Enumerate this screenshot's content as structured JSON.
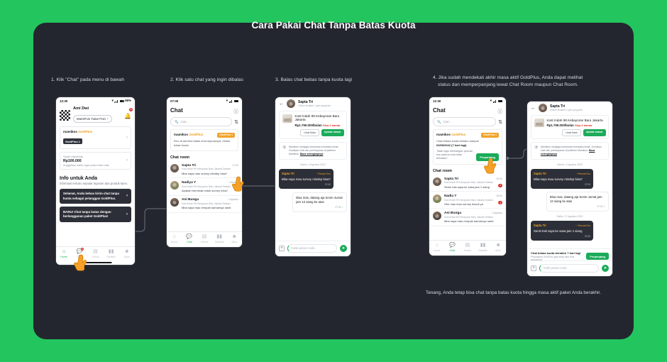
{
  "deck": {
    "title": "Cara Pakai Chat Tanpa Batas Kuota",
    "footnote": "Tenang, Anda tetap bisa chat tanpa batas kuota hingga masa aktif paket Anda berakhir.",
    "bg_color": "#22c55e",
    "panel_color": "#23262e",
    "accent_green": "#1bab5a",
    "accent_gold": "#f2a32a",
    "accent_red": "#e0352b"
  },
  "steps": [
    {
      "num": "1.",
      "text": "1. Klik \"Chat\" pada menu di bawah"
    },
    {
      "num": "2.",
      "text": "2. Klik satu chat yang ingin dibalas"
    },
    {
      "num": "3.",
      "text": "3. Balas chat bebas tanpa kuota lagi"
    },
    {
      "num": "4.",
      "line1": "4. Jika sudah mendekati akhir masa aktif GoldPlus, Anda dapat melihat",
      "line2": "status dan memperpanjang lewat Chat Room maupun Chat Room."
    }
  ],
  "phone1": {
    "status": {
      "time": "12:30",
      "battery": "56%",
      "wifi_icon": "wifi-icon",
      "signal_icon": "signal-bars-icon",
      "battery_icon": "battery-icon"
    },
    "profile": {
      "name": "Ami Dwi",
      "pill": "MamiPoin Tukar Poin",
      "bell_icon": "bell-icon",
      "bell_badge": "0",
      "avatar": "checkerboard-avatar"
    },
    "goldplus_row": {
      "brand": "mamikos",
      "brand_em": "GoldPlus",
      "chip": "GoldPlus 1",
      "chevron": "chevron-right-icon"
    },
    "saldo_row": {
      "label": "Saldo MamiAds",
      "value": "Rp100.000",
      "sub": "Anggarkan saldo agar posisi iklan naik",
      "chevron": "chevron-right-icon"
    },
    "info": {
      "title": "Info untuk Anda",
      "sub": "Informasi terbaru seputar layanan dan produk kami."
    },
    "promos": [
      "Selamat, Anda bebas kirim chat tanpa kuota sebagai pelanggan GoldPlus.",
      "BARU! Chat tanpa batas dengan berlangganan paket GoldPlus!"
    ],
    "tabs": [
      {
        "label": "Home",
        "icon": "home-icon",
        "active": true,
        "badge": ""
      },
      {
        "label": "Chat",
        "icon": "chat-icon",
        "active": false,
        "badge": "1"
      },
      {
        "label": "Kelola",
        "icon": "kelola-icon",
        "active": false,
        "badge": ""
      },
      {
        "label": "Statistik",
        "icon": "statistik-icon",
        "active": false,
        "badge": ""
      },
      {
        "label": "Akun",
        "icon": "akun-icon",
        "active": false,
        "badge": ""
      }
    ],
    "cursor": "hand-pointer-icon"
  },
  "phone2": {
    "status": {
      "time": "07:00",
      "wifi_icon": "wifi-icon",
      "signal_icon": "signal-bars-icon",
      "battery_icon": "battery-icon"
    },
    "title": "Chat",
    "header_icon": "info-circle-icon",
    "search_placeholder": "Cari...",
    "search_icon": "search-icon",
    "filter_icon": "filter-icon",
    "banner": {
      "brand": "mamikos",
      "brand_em": "GoldPlus",
      "chip": "GoldPlus 1",
      "text": "Kini, Anda bisa balas chat sepuasnya, bebas batas kuota"
    },
    "list_title": "Chat room",
    "items": [
      {
        "name": "Sapta Tri",
        "time": "07:00",
        "sub": "Kost Indah 99 Kebayoran Baru Jakarta Selatan",
        "msg": "Mba saya mau survey ntindep bisa?",
        "unread": ""
      },
      {
        "name": "Nadiya Y",
        "time": "Kemarin",
        "sub": "Kost Indah 99 Kebayoran Baru Jakarta Selatan",
        "msg": "Apakah berminat untuk survey mba?",
        "unread": ""
      },
      {
        "name": "Ani Bunga",
        "time": "1 Agustus",
        "sub": "Kost Indah 99 Kebayoran Baru Jakarta Selatan",
        "msg": "Mba saya mau rempah kamarnya nanti",
        "unread": ""
      }
    ],
    "tabs": [
      {
        "label": "Home",
        "icon": "home-icon",
        "active": false,
        "badge": ""
      },
      {
        "label": "Chat",
        "icon": "chat-icon",
        "active": true,
        "badge": ""
      },
      {
        "label": "Kelola",
        "icon": "kelola-icon",
        "active": false,
        "badge": ""
      },
      {
        "label": "Statistik",
        "icon": "statistik-icon",
        "active": false,
        "badge": ""
      },
      {
        "label": "Akun",
        "icon": "akun-icon",
        "active": false,
        "badge": ""
      }
    ],
    "cursor": "hand-pointer-icon"
  },
  "phone3": {
    "room": {
      "back_icon": "arrow-left-icon",
      "name": "Sapta Tri",
      "status": "Online terakhir 1 jam yang lalu",
      "avatar": "user-avatar"
    },
    "kost": {
      "title": "Kost Indah 99 Kebayoran Baru Jakarta",
      "price": "Rp1.750.000/bulan",
      "rooms": "Sisa 3 kamar",
      "btn_ghost": "Lihat Iklan",
      "btn_green": "Update kamar",
      "thumb": "kost-photo"
    },
    "notice": {
      "icon": "shield-icon",
      "text": "Mamikos menjaga keamanan transaksi Anda. Gunakan chat dan pembayaran di platform Mamikos.",
      "link": "Baca selengkapnya"
    },
    "daystamp": "Kamis, 4 Agustus 2022",
    "messages": [
      {
        "side": "them",
        "name": "Sapta Tri",
        "tag": "~ Pencari Kos",
        "text": "Mba saya mau survey ntindep bisa?",
        "time": "07:00"
      },
      {
        "side": "me",
        "text": "Bisa mas, datang aja Senin-Jumat jam 12 siang ke atas",
        "time": "07:30",
        "tick": "✓"
      }
    ],
    "composer": {
      "plus_icon": "plus-icon",
      "placeholder": "Ketik pesan Anda",
      "send_icon": "send-icon"
    }
  },
  "phone4": {
    "status": {
      "time": "12:30",
      "wifi_icon": "wifi-icon",
      "signal_icon": "signal-bars-icon",
      "battery_icon": "battery-icon"
    },
    "title": "Chat",
    "header_icon": "info-circle-icon",
    "search_placeholder": "Cari...",
    "search_icon": "search-icon",
    "filter_icon": "filter-icon",
    "banner": {
      "brand": "mamikos",
      "brand_em": "GoldPlus",
      "chip": "GoldPlus 1",
      "text_1": "Chat bebas kuota berlaku sampai",
      "text_2": "03/09/2022 (7 hari lagi)",
      "question": "Tidak ingin kehilangan pencari kos karena chat tidak terbalas?",
      "btn": "Perpanjang"
    },
    "list_title": "Chat room",
    "items": [
      {
        "name": "Sapta Tri",
        "time": "09:30",
        "sub": "Kost Indah 99 Kebayoran Baru Jakarta Selatan",
        "msg": "Senin bsk saya ke sana jam 1 siang",
        "unread": "1"
      },
      {
        "name": "Nadia Y",
        "time": "08:00",
        "sub": "Kost Indah 99 Kebayoran Baru Jakarta Selatan",
        "msg": "Oke mas mau survey besok ya",
        "unread": "2"
      },
      {
        "name": "Ani Bunga",
        "time": "1 Agustus",
        "sub": "Kost Indah 99 Kebayoran Baru Jakarta Selatan",
        "msg": "Mba saya mau rempah kamarnya nanti",
        "unread": ""
      }
    ],
    "tabs": [
      {
        "label": "Home",
        "icon": "home-icon",
        "active": false,
        "badge": ""
      },
      {
        "label": "Chat",
        "icon": "chat-icon",
        "active": true,
        "badge": ""
      },
      {
        "label": "Kelola",
        "icon": "kelola-icon",
        "active": false,
        "badge": ""
      },
      {
        "label": "Statistik",
        "icon": "statistik-icon",
        "active": false,
        "badge": ""
      },
      {
        "label": "Akun",
        "icon": "akun-icon",
        "active": false,
        "badge": ""
      }
    ],
    "cursor": "hand-pointer-icon"
  },
  "phone5": {
    "room": {
      "back_icon": "arrow-left-icon",
      "name": "Sapta Tri",
      "status": "Online terakhir 2 jam yang lalu",
      "avatar": "user-avatar"
    },
    "kost": {
      "title": "Kost Indah 99 Kebayoran Baru Jakarta",
      "price": "Rp1.750.000/bulan",
      "rooms": "Sisa 3 kamar",
      "btn_ghost": "Lihat Iklan",
      "btn_green": "Update kamar",
      "thumb": "kost-photo"
    },
    "notice": {
      "icon": "shield-icon",
      "text": "Mamikos menjaga keamanan transaksi Anda. Gunakan chat dan pembayaran di platform Mamikos.",
      "link": "Baca selengkapnya"
    },
    "daystamp_1": "Kamis, 4 Agustus 2022",
    "daystamp_2": "Sabtu, 27 Agustus 2022",
    "messages": [
      {
        "side": "them",
        "name": "Sapta Tri",
        "tag": "~ Pencari Kos",
        "text": "Mba saya mau survey ntindep bisa?",
        "time": "07:00"
      },
      {
        "side": "me",
        "text": "Bisa mas, datang aja Senin-Jumat jam 12 siang ke atas",
        "time": "07:30",
        "tick": "✓"
      },
      {
        "side": "them",
        "name": "Sapta Tri",
        "tag": "~ Pencari Kos",
        "text": "Senin bsk saya ke sana jam 1 siang",
        "time": "09:30"
      }
    ],
    "expire": {
      "title": "Chat bebas kuota berakhir 7 hari lagi",
      "sub": "Perpanjang GoldPlus agar tetap bisa chat sepuasnya",
      "btn": "Perpanjang"
    },
    "composer": {
      "plus_icon": "plus-icon",
      "placeholder": "Ketik pesan Anda",
      "send_icon": "send-icon"
    }
  }
}
